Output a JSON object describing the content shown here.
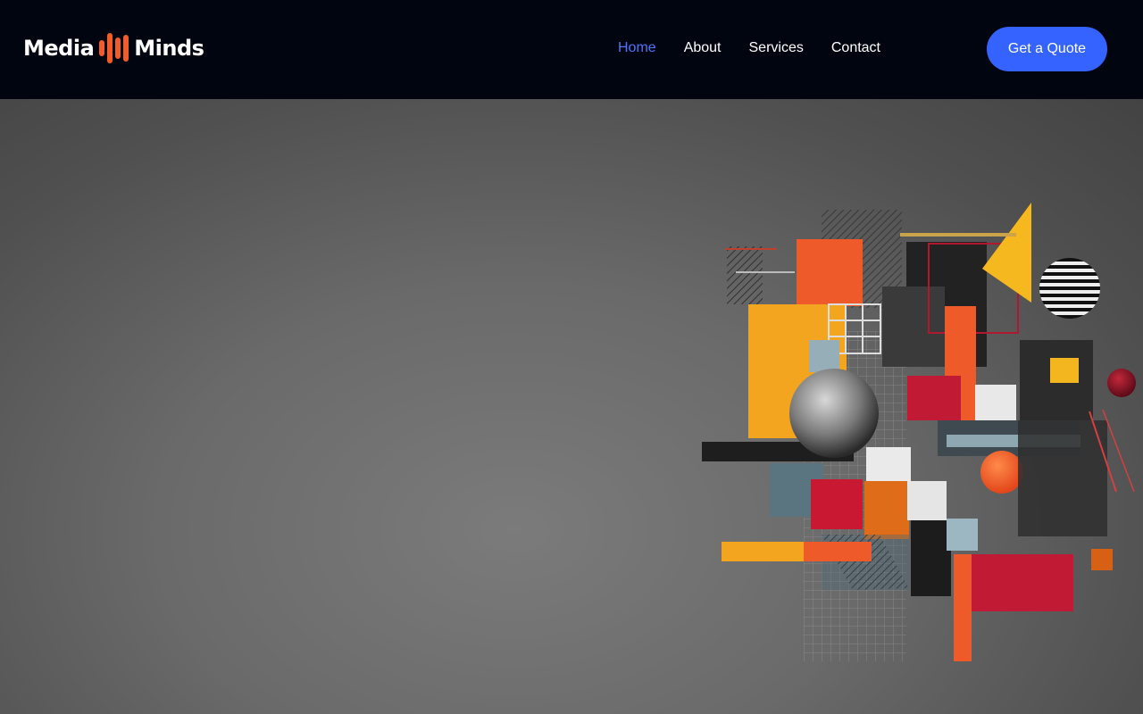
{
  "brand": {
    "word_left": "Media",
    "word_right": "Minds",
    "accent": "#f25b2a"
  },
  "nav": {
    "items": [
      {
        "label": "Home",
        "active": true
      },
      {
        "label": "About",
        "active": false
      },
      {
        "label": "Services",
        "active": false
      },
      {
        "label": "Contact",
        "active": false
      }
    ],
    "active_color": "#4d74ff"
  },
  "cta": {
    "label": "Get a Quote",
    "color": "#3563ff"
  },
  "hero": {
    "artwork": "abstract-geometric-collage"
  }
}
